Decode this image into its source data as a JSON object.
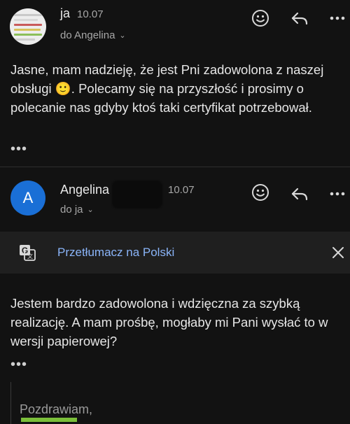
{
  "message1": {
    "sender": "ja",
    "date": "10.07",
    "recipient_line": "do Angelina",
    "body": "Jasne, mam nadzieję, że jest Pni zadowolona z naszej obsługi 🙂. Polecamy się na przyszłość i prosimy o polecanie nas gdyby ktoś taki certyfikat potrzebował.",
    "more": "•••"
  },
  "message2": {
    "avatar_letter": "A",
    "sender": "Angelina",
    "date": "10.07",
    "recipient_line": "do ja",
    "body": "Jestem bardzo zadowolona i wdzięczna za szybką realizację. A mam prośbę, mogłaby mi Pani wysłać to w wersji papierowej?",
    "more": "•••",
    "quoted_greeting": "Pozdrawiam,"
  },
  "translate": {
    "label": "Przetłumacz na Polski"
  },
  "icons": [
    "emoji-reaction-icon",
    "reply-icon",
    "more-options-icon",
    "translate-icon",
    "close-icon",
    "chevron-down-icon"
  ],
  "colors": {
    "background": "#121212",
    "translate_bar": "#1f1f1f",
    "link_blue": "#8ab4f8",
    "avatar_blue": "#1a6fd6"
  }
}
